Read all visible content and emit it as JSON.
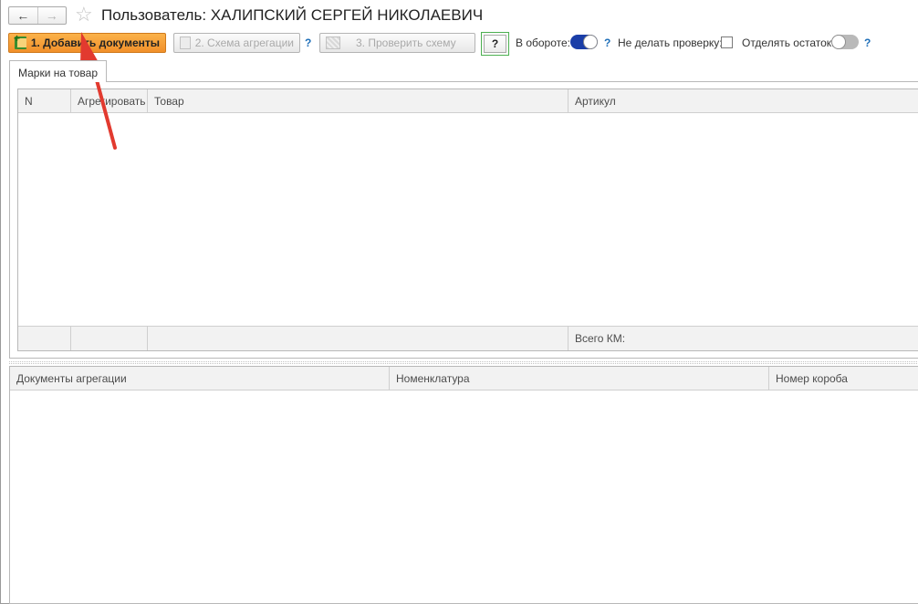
{
  "window": {
    "title": "Пользователь: ХАЛИПСКИЙ СЕРГЕЙ НИКОЛАЕВИЧ",
    "back_icon": "←",
    "forward_icon": "→",
    "favorite_icon": "☆"
  },
  "toolbar": {
    "add_documents_label": "1. Добавить документы",
    "aggregation_scheme_label": "2. Схема агрегации",
    "check_scheme_label": "3. Проверить схему",
    "help_button_label": "?",
    "help_mark": "?",
    "in_circulation_label": "В обороте:",
    "in_circulation_on": true,
    "no_check_label": "Не делать проверку:",
    "no_check_checked": false,
    "separate_rest_label": "Отделять остаток:",
    "separate_rest_on": false
  },
  "tabs": [
    {
      "label": "Марки на товар"
    }
  ],
  "marks_table": {
    "columns": [
      "N",
      "Агрегировать",
      "Товар",
      "Артикул"
    ],
    "rows": [],
    "footer_total_label": "Всего КМ:"
  },
  "aggregation_table": {
    "columns": [
      "Документы  агрегации",
      "Номенклатура",
      "Номер короба"
    ],
    "rows": []
  },
  "colors": {
    "primary_button": "#f1902a",
    "toggle_on": "#1a3ea8",
    "help_link": "#1f6fb8",
    "highlight_frame": "#4caf50",
    "annotation_arrow": "#e23a2f"
  },
  "icons": {
    "add_documents": "add-document-icon",
    "aggregation_scheme": "scheme-icon",
    "check_scheme": "check-scheme-icon"
  }
}
